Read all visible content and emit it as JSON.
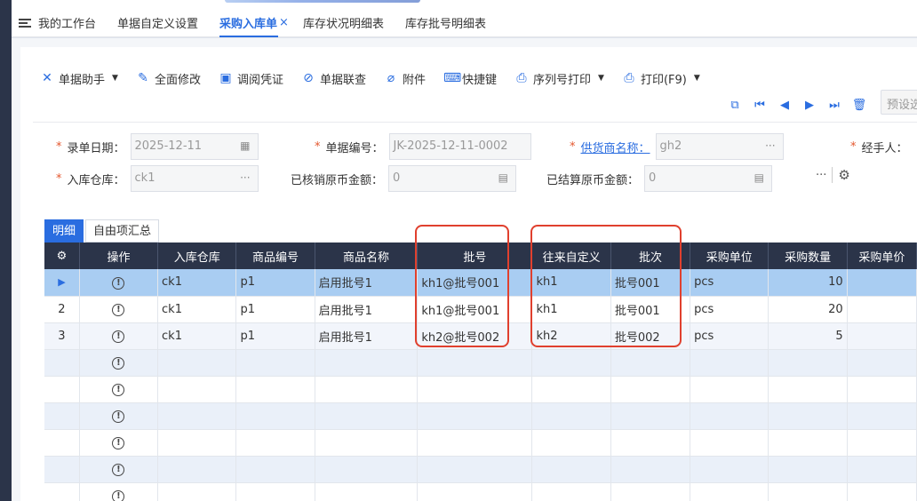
{
  "tabs": [
    {
      "label": "我的工作台",
      "active": false
    },
    {
      "label": "单据自定义设置",
      "active": false
    },
    {
      "label": "采购入库单",
      "active": true,
      "close": "×"
    },
    {
      "label": "库存状况明细表",
      "active": false
    },
    {
      "label": "库存批号明细表",
      "active": false
    }
  ],
  "toolbar": [
    {
      "icon": "tools-icon",
      "glyph": "✕",
      "label": "单据助手",
      "caret": "▼"
    },
    {
      "icon": "edit-icon",
      "glyph": "✎",
      "label": "全面修改"
    },
    {
      "icon": "voucher-icon",
      "glyph": "▣",
      "label": "调阅凭证"
    },
    {
      "icon": "link-icon",
      "glyph": "⊘",
      "label": "单据联查"
    },
    {
      "icon": "paperclip-icon",
      "glyph": "⌀",
      "label": "附件"
    },
    {
      "icon": "keyboard-icon",
      "glyph": "⌨",
      "label": "快捷键"
    },
    {
      "icon": "printer-icon",
      "glyph": "⎙",
      "label": "序列号打印",
      "caret": "▼"
    },
    {
      "icon": "printer-icon",
      "glyph": "⎙",
      "label": "打印(F9)",
      "caret": "▼"
    }
  ],
  "nav": {
    "icons": [
      "copy-icon",
      "first-icon",
      "prev-icon",
      "next-icon",
      "last-icon",
      "delete-icon"
    ],
    "glyphs": [
      "⧉",
      "⏮",
      "◀",
      "▶",
      "⏭",
      "🗑"
    ],
    "preset_placeholder": "预设选"
  },
  "form": {
    "entry_date": {
      "label": "录单日期：",
      "value": "2025-12-11",
      "required": "*"
    },
    "doc_no": {
      "label": "单据编号：",
      "value": "JK-2025-12-11-0002",
      "required": "*"
    },
    "supplier": {
      "label": "供货商名称：",
      "value": "gh2",
      "required": "*"
    },
    "handler": {
      "label": "经手人：",
      "required": "*"
    },
    "warehouse": {
      "label": "入库仓库：",
      "value": "ck1",
      "required": "*"
    },
    "verified_amount": {
      "label": "已核销原币金额：",
      "value": "0"
    },
    "settled_amount": {
      "label": "已结算原币金额：",
      "value": "0"
    },
    "more": "···"
  },
  "subtabs": [
    "明细",
    "自由项汇总"
  ],
  "grid": {
    "columns": [
      "操作",
      "入库仓库",
      "商品编号",
      "商品名称",
      "批号",
      "往来自定义",
      "批次",
      "采购单位",
      "采购数量",
      "采购单价"
    ],
    "rows": [
      {
        "row": "▶",
        "warehouse": "ck1",
        "code": "p1",
        "name": "启用批号1",
        "batch_no": "kh1@批号001",
        "custom": "kh1",
        "lot": "批号001",
        "unit": "pcs",
        "qty": "10",
        "price": ""
      },
      {
        "row": "2",
        "warehouse": "ck1",
        "code": "p1",
        "name": "启用批号1",
        "batch_no": "kh1@批号001",
        "custom": "kh1",
        "lot": "批号001",
        "unit": "pcs",
        "qty": "20",
        "price": ""
      },
      {
        "row": "3",
        "warehouse": "ck1",
        "code": "p1",
        "name": "启用批号1",
        "batch_no": "kh2@批号002",
        "custom": "kh2",
        "lot": "批号002",
        "unit": "pcs",
        "qty": "5",
        "price": ""
      }
    ],
    "op_glyph": "!",
    "empty_rows": 6
  },
  "colors": {
    "accent": "#2a6de0",
    "header_bg": "#2b3449",
    "selected_row": "#a9cdf2",
    "highlight_box": "#e0402e"
  }
}
